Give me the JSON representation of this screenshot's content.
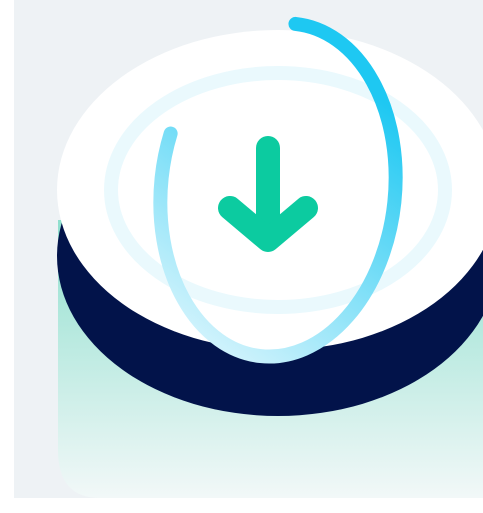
{
  "illustration": {
    "icon": "download-arrow-icon",
    "progress_fraction": 0.8,
    "colors": {
      "panel_background": "#eef2f5",
      "disc_top": "#ffffff",
      "disc_side": "#02134a",
      "glow_top": "#8fdfce",
      "glow_bottom": "#f2f8f8",
      "progress_start": "#e6f8fd",
      "progress_end": "#1ec8f2",
      "arrow": "#0ccba0"
    }
  }
}
